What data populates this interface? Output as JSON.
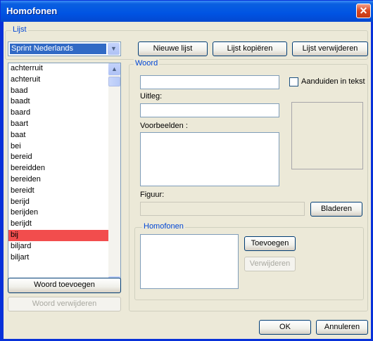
{
  "window": {
    "title": "Homofonen",
    "close_glyph": "✕"
  },
  "lijst": {
    "legend": "Lijst",
    "selected": "Sprint Nederlands",
    "buttons": {
      "new": "Nieuwe lijst",
      "copy": "Lijst kopiëren",
      "delete": "Lijst verwijderen"
    }
  },
  "words": [
    "achterruit",
    "achteruit",
    "baad",
    "baadt",
    "baard",
    "baart",
    "baat",
    "bei",
    "bereid",
    "bereidden",
    "bereiden",
    "bereidt",
    "berijd",
    "berijden",
    "berijdt",
    "bij",
    "biljard",
    "biljart"
  ],
  "selected_word_index": 15,
  "word_buttons": {
    "add": "Woord toevoegen",
    "remove": "Woord verwijderen"
  },
  "woord": {
    "legend": "Woord",
    "value": "",
    "mark_in_text_label": "Aanduiden in tekst",
    "uitleg_label": "Uitleg:",
    "uitleg_value": "",
    "voorbeelden_label": "Voorbeelden :",
    "figuur_label": "Figuur:",
    "browse": "Bladeren"
  },
  "homofonen": {
    "legend": "Homofonen",
    "add": "Toevoegen",
    "remove": "Verwijderen"
  },
  "dialog": {
    "ok": "OK",
    "cancel": "Annuleren"
  }
}
